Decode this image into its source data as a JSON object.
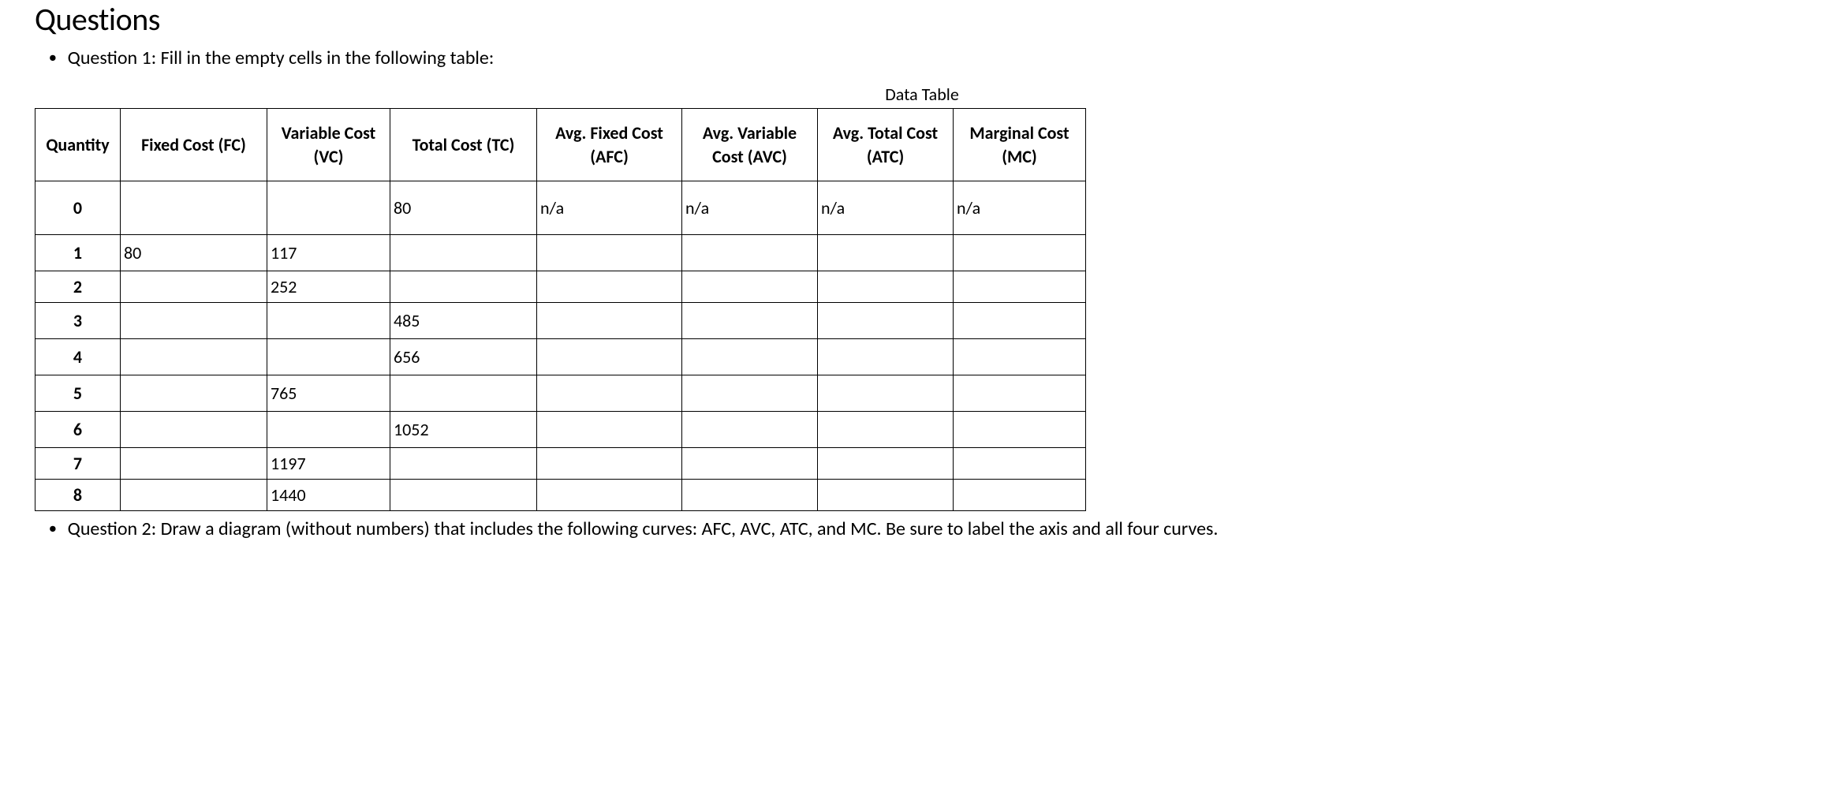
{
  "heading": "Questions",
  "question1": "Question 1: Fill in the empty cells in the following table:",
  "table": {
    "caption": "Data Table",
    "headers": {
      "quantity": "Quantity",
      "fc": "Fixed Cost (FC)",
      "vc": "Variable Cost (VC)",
      "tc": "Total Cost (TC)",
      "afc": "Avg. Fixed Cost (AFC)",
      "avc": "Avg. Variable Cost (AVC)",
      "atc": "Avg. Total Cost (ATC)",
      "mc": "Marginal Cost (MC)"
    },
    "rows": [
      {
        "qty": "0",
        "fc": "",
        "vc": "",
        "tc": "80",
        "afc": "n/a",
        "avc": "n/a",
        "atc": "n/a",
        "mc": "n/a"
      },
      {
        "qty": "1",
        "fc": "80",
        "vc": "117",
        "tc": "",
        "afc": "",
        "avc": "",
        "atc": "",
        "mc": ""
      },
      {
        "qty": "2",
        "fc": "",
        "vc": "252",
        "tc": "",
        "afc": "",
        "avc": "",
        "atc": "",
        "mc": ""
      },
      {
        "qty": "3",
        "fc": "",
        "vc": "",
        "tc": "485",
        "afc": "",
        "avc": "",
        "atc": "",
        "mc": ""
      },
      {
        "qty": "4",
        "fc": "",
        "vc": "",
        "tc": "656",
        "afc": "",
        "avc": "",
        "atc": "",
        "mc": ""
      },
      {
        "qty": "5",
        "fc": "",
        "vc": "765",
        "tc": "",
        "afc": "",
        "avc": "",
        "atc": "",
        "mc": ""
      },
      {
        "qty": "6",
        "fc": "",
        "vc": "",
        "tc": "1052",
        "afc": "",
        "avc": "",
        "atc": "",
        "mc": ""
      },
      {
        "qty": "7",
        "fc": "",
        "vc": "1197",
        "tc": "",
        "afc": "",
        "avc": "",
        "atc": "",
        "mc": ""
      },
      {
        "qty": "8",
        "fc": "",
        "vc": "1440",
        "tc": "",
        "afc": "",
        "avc": "",
        "atc": "",
        "mc": ""
      }
    ]
  },
  "question2": "Question 2: Draw a diagram (without numbers) that includes the following curves: AFC, AVC, ATC, and MC.  Be sure to label the axis and all four curves."
}
